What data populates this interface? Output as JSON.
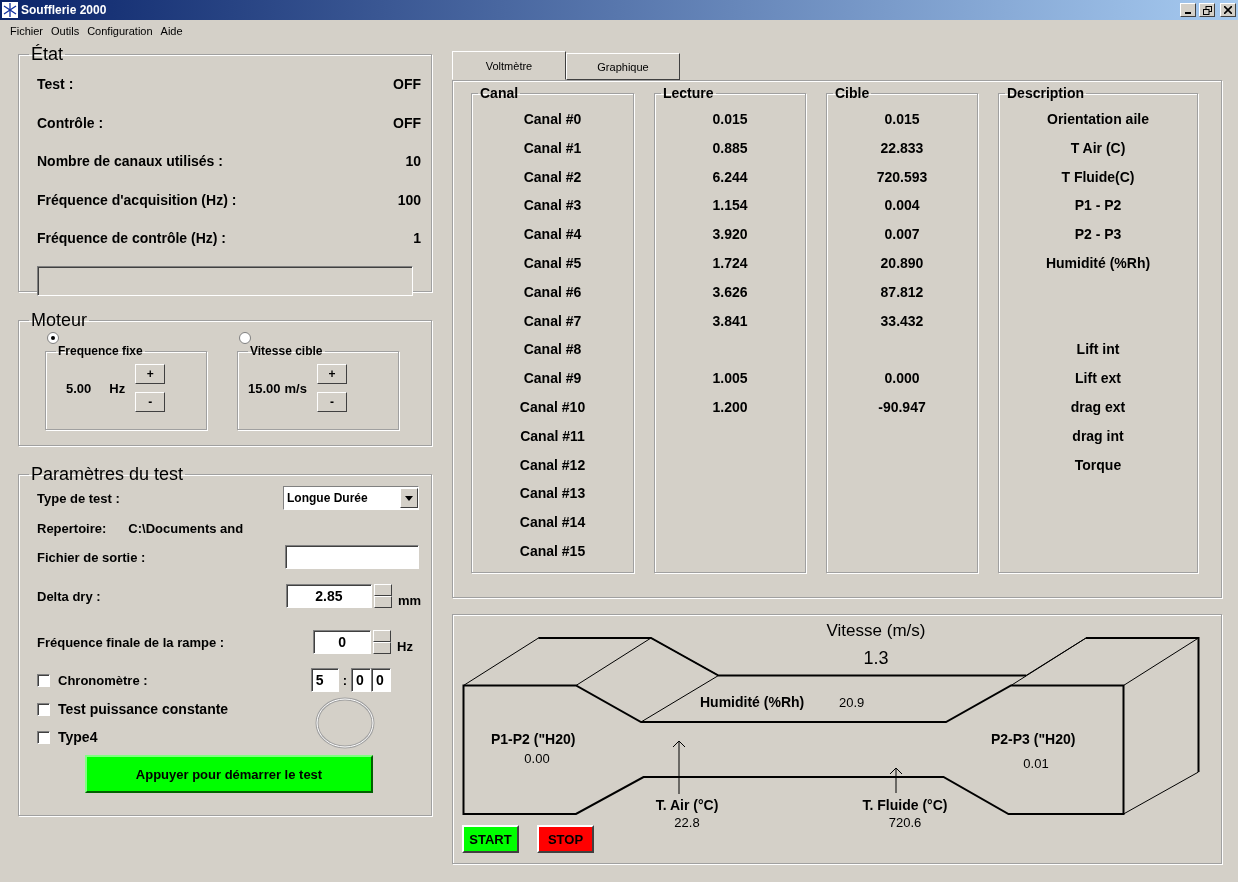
{
  "window": {
    "title": "Soufflerie 2000"
  },
  "menu": [
    "Fichier",
    "Outils",
    "Configuration",
    "Aide"
  ],
  "state_panel": {
    "title": "État",
    "rows": [
      {
        "label": "Test :",
        "value": "OFF"
      },
      {
        "label": "Contrôle :",
        "value": "OFF"
      },
      {
        "label": "Nombre de canaux utilisés :",
        "value": "10"
      },
      {
        "label": "Fréquence d'acquisition (Hz) :",
        "value": "100"
      },
      {
        "label": "Fréquence de contrôle (Hz) :",
        "value": "1"
      }
    ],
    "progress": {
      "level": 0
    }
  },
  "motor_panel": {
    "title": "Moteur",
    "modes": [
      {
        "title": "Frequence fixe",
        "selected": true,
        "value": "5.00",
        "unit": "Hz",
        "buttons": [
          "+",
          "-"
        ]
      },
      {
        "title": "Vitesse cible",
        "selected": false,
        "value": "15.00",
        "unit": "m/s",
        "buttons": [
          "+",
          "-"
        ]
      }
    ]
  },
  "test_panel": {
    "title": "Paramètres du test",
    "test_type": {
      "label": "Type de test :",
      "value": "Longue Durée"
    },
    "directory": {
      "label": "Repertoire:",
      "value": "C:\\Documents and"
    },
    "output_file": {
      "label": "Fichier de sortie :"
    },
    "delta_dry": {
      "label": "Delta dry :",
      "value": "2.85",
      "unit": "mm"
    },
    "ramp": {
      "label": "Fréquence finale de la rampe :",
      "value": "0",
      "unit": "Hz"
    },
    "chrono": {
      "label": "Chronomètre :",
      "checked": false,
      "minutes": "5",
      "separator": ":",
      "seconds": [
        "0",
        "0"
      ]
    },
    "options": [
      {
        "label": "Test puissance constante",
        "checked": false
      },
      {
        "label": "Type4",
        "checked": false
      }
    ],
    "start_button": "Appuyer pour démarrer le test"
  },
  "tabs": [
    {
      "label": "Voltmètre",
      "selected": true
    },
    {
      "label": "Graphique",
      "selected": false
    }
  ],
  "channels": {
    "columns": [
      "Canal",
      "Lecture",
      "Cible",
      "Description"
    ],
    "rows": [
      {
        "canal": "Canal #0",
        "lecture": "0.015",
        "cible": "0.015",
        "description": "Orientation aile"
      },
      {
        "canal": "Canal #1",
        "lecture": "0.885",
        "cible": "22.833",
        "description": "T Air (C)"
      },
      {
        "canal": "Canal #2",
        "lecture": "6.244",
        "cible": "720.593",
        "description": "T Fluide(C)"
      },
      {
        "canal": "Canal #3",
        "lecture": "1.154",
        "cible": "0.004",
        "description": "P1 - P2"
      },
      {
        "canal": "Canal #4",
        "lecture": "3.920",
        "cible": "0.007",
        "description": "P2 - P3"
      },
      {
        "canal": "Canal #5",
        "lecture": "1.724",
        "cible": "20.890",
        "description": "Humidité (%Rh)"
      },
      {
        "canal": "Canal #6",
        "lecture": "3.626",
        "cible": "87.812"
      },
      {
        "canal": "Canal #7",
        "lecture": "3.841",
        "cible": "33.432"
      },
      {
        "canal": "Canal #8",
        "description": "Lift int"
      },
      {
        "canal": "Canal #9",
        "lecture": "1.005",
        "cible": "0.000",
        "description": "Lift ext"
      },
      {
        "canal": "Canal #10",
        "lecture": "1.200",
        "cible": "-90.947",
        "description": "drag ext"
      },
      {
        "canal": "Canal #11",
        "description": "drag int"
      },
      {
        "canal": "Canal #12",
        "description": "Torque"
      },
      {
        "canal": "Canal #13"
      },
      {
        "canal": "Canal #14"
      },
      {
        "canal": "Canal #15"
      }
    ]
  },
  "tunnel": {
    "speed_label": "Vitesse (m/s)",
    "speed": "1.3",
    "humidity": {
      "label": "Humidité (%Rh)",
      "value": "20.9"
    },
    "p1_p2": {
      "label": "P1-P2 (\"H20)",
      "value": "0.00"
    },
    "p2_p3": {
      "label": "P2-P3 (\"H20)",
      "value": "0.01"
    },
    "t_air": {
      "label": "T. Air (°C)",
      "value": "22.8"
    },
    "t_fluid": {
      "label": "T. Fluide (°C)",
      "value": "720.6"
    },
    "start": "START",
    "stop": "STOP"
  }
}
